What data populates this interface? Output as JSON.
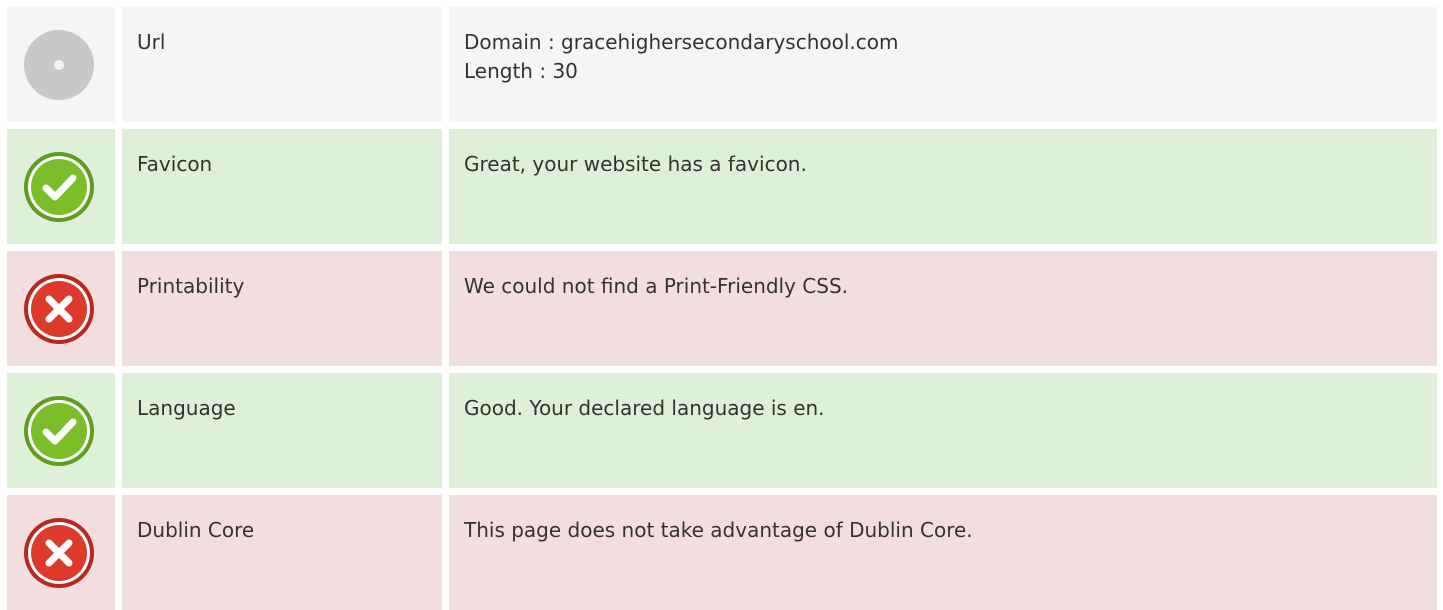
{
  "colors": {
    "neutral_bg": "#f5f5f5",
    "good_bg": "#dff0d8",
    "bad_bg": "#f2dede",
    "good_icon": "#7cbd2a",
    "bad_icon": "#dd3a2c",
    "neutral_icon": "#c8c8c8"
  },
  "rows": [
    {
      "status": "neutral",
      "icon": "neutral-circle-icon",
      "label": "Url",
      "lines": [
        "Domain : gracehighersecondaryschool.com",
        "Length : 30"
      ]
    },
    {
      "status": "good",
      "icon": "check-circle-icon",
      "label": "Favicon",
      "lines": [
        "Great, your website has a favicon."
      ]
    },
    {
      "status": "bad",
      "icon": "error-circle-icon",
      "label": "Printability",
      "lines": [
        "We could not find a Print-Friendly CSS."
      ]
    },
    {
      "status": "good",
      "icon": "check-circle-icon",
      "label": "Language",
      "lines": [
        "Good. Your declared language is en."
      ]
    },
    {
      "status": "bad",
      "icon": "error-circle-icon",
      "label": "Dublin Core",
      "lines": [
        "This page does not take advantage of Dublin Core."
      ]
    }
  ]
}
